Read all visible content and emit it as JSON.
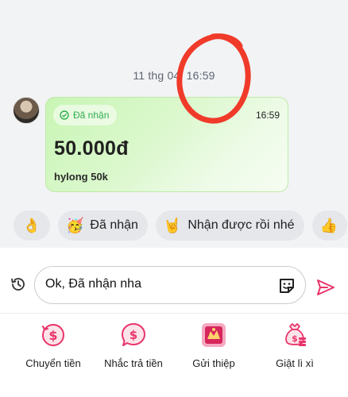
{
  "chat": {
    "timestamp": "11 thg 04, 16:59",
    "transfer_card": {
      "status": "Đã nhận",
      "time": "16:59",
      "amount": "50.000đ",
      "note": "hylong 50k"
    },
    "quick_replies": [
      {
        "emoji": "👌",
        "label": ""
      },
      {
        "emoji": "🥳",
        "label": "Đã nhận"
      },
      {
        "emoji": "🤘",
        "label": "Nhận được rồi nhé"
      },
      {
        "emoji": "👍",
        "label": ""
      }
    ]
  },
  "composer": {
    "input_value": "Ok, Đã nhận nha"
  },
  "actions": [
    {
      "label": "Chuyển tiền",
      "icon": "money-transfer-icon"
    },
    {
      "label": "Nhắc trả tiền",
      "icon": "payment-reminder-icon"
    },
    {
      "label": "Gửi thiệp",
      "icon": "greeting-card-icon"
    },
    {
      "label": "Giật lì xì",
      "icon": "lucky-money-icon"
    }
  ],
  "colors": {
    "accent": "#e8346a",
    "received_green": "#2fae51",
    "annotation_red": "#f03a2a"
  }
}
